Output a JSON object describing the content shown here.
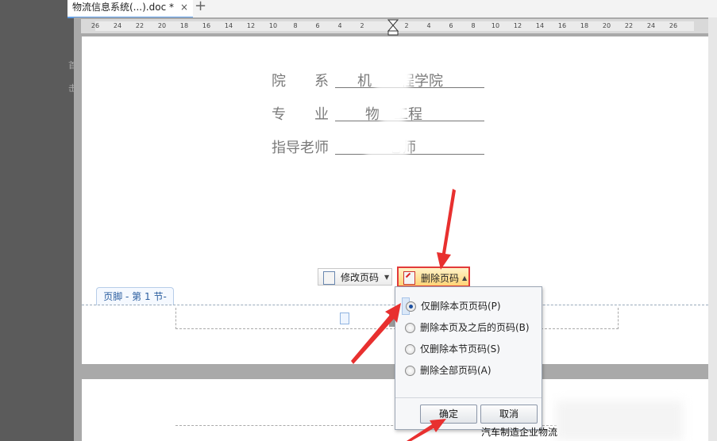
{
  "tab": {
    "title": "物流信息系统(...).doc *",
    "close": "×",
    "new_tab": "+"
  },
  "left_ghost": [
    "首",
    "击"
  ],
  "ruler": {
    "left_numbers": [
      "26",
      "24",
      "22",
      "20",
      "18",
      "16",
      "14",
      "12",
      "10",
      "8",
      "6",
      "4",
      "2"
    ],
    "right_numbers": [
      "2",
      "4",
      "6",
      "8",
      "10",
      "12",
      "14",
      "16",
      "18",
      "20",
      "22",
      "24",
      "26"
    ]
  },
  "document": {
    "rows": [
      {
        "label": "院　　系",
        "value": "机　　程学院"
      },
      {
        "label": "专　　业",
        "value": "物　工程"
      },
      {
        "label": "指导老师",
        "value": "　老师"
      }
    ]
  },
  "footer_tab": "页脚 - 第 1 节-",
  "toolbar": {
    "modify_label": "修改页码",
    "delete_label": "删除页码"
  },
  "popup": {
    "options": [
      {
        "label": "仅删除本页页码(P)",
        "selected": true
      },
      {
        "label": "删除本页及之后的页码(B)",
        "selected": false
      },
      {
        "label": "仅删除本节页码(S)",
        "selected": false
      },
      {
        "label": "删除全部页码(A)",
        "selected": false
      }
    ],
    "ok": "确定",
    "cancel": "取消"
  },
  "page2_text": "汽车制造企业物流",
  "colors": {
    "highlight": "#e23a3a",
    "arrow": "#e8302f",
    "canvas": "#a9a9a9"
  }
}
